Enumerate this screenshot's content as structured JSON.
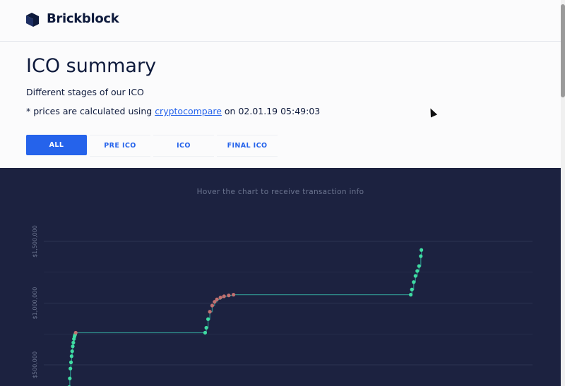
{
  "header": {
    "brand": "Brickblock",
    "logo": "brickblock-logo-icon"
  },
  "page": {
    "title": "ICO summary",
    "subtitle": "Different stages of our ICO",
    "note_prefix": "* prices are calculated using ",
    "note_link": "cryptocompare",
    "note_suffix": " on 02.01.19 05:49:03"
  },
  "tabs": [
    {
      "label": "ALL",
      "active": true
    },
    {
      "label": "PRE ICO",
      "active": false
    },
    {
      "label": "ICO",
      "active": false
    },
    {
      "label": "FINAL ICO",
      "active": false
    }
  ],
  "chart": {
    "hint": "Hover the chart to receive transaction info",
    "colors": {
      "background": "#1c2240",
      "line": "#2e8c8a",
      "point_green": "#3fdca2",
      "point_red": "#c07070",
      "grid": "#2d3452"
    }
  },
  "chart_data": {
    "type": "scatter",
    "title": "",
    "xlabel": "",
    "ylabel": "",
    "y_ticks": [
      "$500,000",
      "$1,000,000",
      "$1,500,000"
    ],
    "y_tick_values": [
      500000,
      1000000,
      1500000
    ],
    "ylim": [
      300000,
      1500000
    ],
    "grid": true,
    "series": [
      {
        "stage": "PRE ICO",
        "x": [
          0,
          1,
          2,
          3,
          4,
          5,
          6,
          7,
          8,
          9,
          10,
          11
        ],
        "y": [
          320000,
          390000,
          470000,
          520000,
          570000,
          610000,
          650000,
          680000,
          710000,
          730000,
          745000,
          760000
        ]
      },
      {
        "stage": "ICO",
        "x": [
          230,
          232,
          235,
          238,
          242,
          246,
          250,
          256,
          262,
          270,
          278
        ],
        "y": [
          760000,
          800000,
          870000,
          930000,
          980000,
          1010000,
          1030000,
          1045000,
          1055000,
          1062000,
          1068000
        ]
      },
      {
        "stage": "FINAL ICO",
        "x": [
          578,
          580,
          583,
          586,
          589,
          592,
          595,
          596
        ],
        "y": [
          1068000,
          1110000,
          1170000,
          1220000,
          1260000,
          1300000,
          1380000,
          1430000
        ]
      }
    ]
  }
}
